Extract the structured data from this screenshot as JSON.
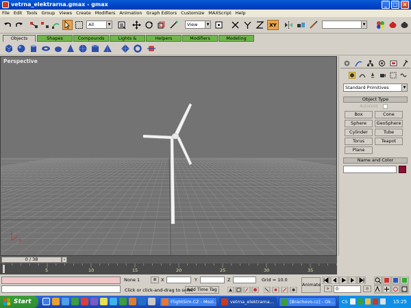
{
  "window": {
    "title": "vetrna_elektrarna.gmax - gmax"
  },
  "window_controls": [
    "minimize",
    "maximize",
    "close"
  ],
  "menu": [
    "File",
    "Edit",
    "Tools",
    "Group",
    "Views",
    "Create",
    "Modifiers",
    "Animation",
    "Graph Editors",
    "Customize",
    "MAXScript",
    "Help"
  ],
  "toolbar": {
    "selection_filter": "All",
    "reference_coord": "View",
    "axis_constraint": "XY",
    "named_selection": ""
  },
  "tabs": [
    "Objects",
    "Shapes",
    "Compounds",
    "Lights & Cameras",
    "Helpers",
    "Modifiers",
    "Modeling"
  ],
  "viewport": {
    "label": "Perspective",
    "axis_x": "x",
    "axis_z": "z"
  },
  "command_panel": {
    "category_dropdown": "Standard Primitives",
    "object_type_title": "Object Type",
    "autogrid_label": "AutoGrid",
    "primitives": [
      "Box",
      "Cone",
      "Sphere",
      "GeoSphere",
      "Cylinder",
      "Tube",
      "Torus",
      "Teapot",
      "Plane"
    ],
    "name_color_title": "Name and Color",
    "object_name": "",
    "color": "#8b1031"
  },
  "timeline": {
    "slider_text": "0 / 38",
    "ticks": [
      "5",
      "10",
      "15",
      "20",
      "25",
      "30",
      "35"
    ]
  },
  "status": {
    "selection": "None 1",
    "x_label": "X",
    "y_label": "Y",
    "z_label": "Z",
    "x_value": "",
    "y_value": "",
    "z_value": "",
    "grid": "Grid = 10.0",
    "prompt": "Click or click-and-drag to selec",
    "add_time_tag": "Add Time Tag",
    "animate_label": "Animate",
    "frame_value": "0"
  },
  "taskbar": {
    "start_label": "Start",
    "tasks": [
      "FlightSim.CZ - Mozi...",
      "vetrna_elektrarna...",
      "[Brachovo.cz] - Ok..."
    ],
    "language": "CS",
    "clock": "15:25"
  },
  "colors": {
    "viewport_bg": "#737373",
    "tab_green": "#6fb54b",
    "taskbar_blue": "#2457c5",
    "start_green": "#3a9a3a"
  }
}
